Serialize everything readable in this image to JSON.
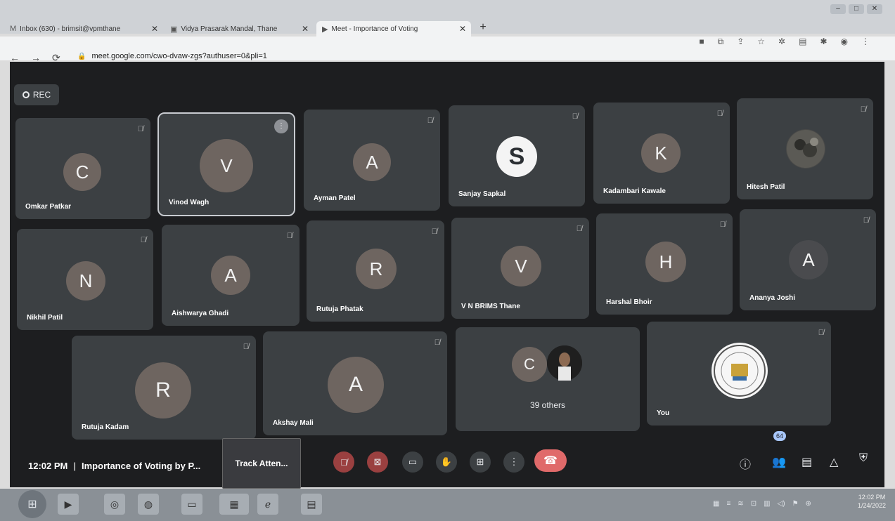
{
  "browser": {
    "tabs": [
      {
        "label": "Inbox (630) - brimsit@vpmthane",
        "icon": "gmail-icon"
      },
      {
        "label": "Vidya Prasarak Mandal, Thane",
        "icon": "site-icon"
      },
      {
        "label": "Meet - Importance of Voting",
        "icon": "meet-icon"
      }
    ],
    "url": "meet.google.com/cwo-dvaw-zgs?authuser=0&pli=1"
  },
  "rec_label": "REC",
  "tiles": [
    {
      "name": "Omkar Patkar",
      "initial": "C"
    },
    {
      "name": "Vinod Wagh",
      "initial": "V",
      "speaking": true
    },
    {
      "name": "Ayman Patel",
      "initial": "A"
    },
    {
      "name": "Sanjay Sapkal",
      "initial": "S"
    },
    {
      "name": "Kadambari Kawale",
      "initial": "K"
    },
    {
      "name": "Hitesh Patil",
      "initial": ""
    },
    {
      "name": "Nikhil Patil",
      "initial": "N"
    },
    {
      "name": "Aishwarya Ghadi",
      "initial": "A"
    },
    {
      "name": "Rutuja Phatak",
      "initial": "R"
    },
    {
      "name": "V N BRIMS Thane",
      "initial": "V"
    },
    {
      "name": "Harshal Bhoir",
      "initial": "H"
    },
    {
      "name": "Ananya Joshi",
      "initial": "A"
    },
    {
      "name": "Rutuja Kadam",
      "initial": "R"
    },
    {
      "name": "Akshay Mali",
      "initial": "A"
    },
    {
      "name": "39 others",
      "initial": "C"
    },
    {
      "name": "You",
      "initial": ""
    }
  ],
  "meeting": {
    "time": "12:02 PM",
    "separator": "|",
    "title": "Importance of Voting by P...",
    "track_label": "Track Atten...",
    "participant_count": "64"
  },
  "taskbar": {
    "time": "12:02 PM",
    "date": "1/24/2022"
  }
}
